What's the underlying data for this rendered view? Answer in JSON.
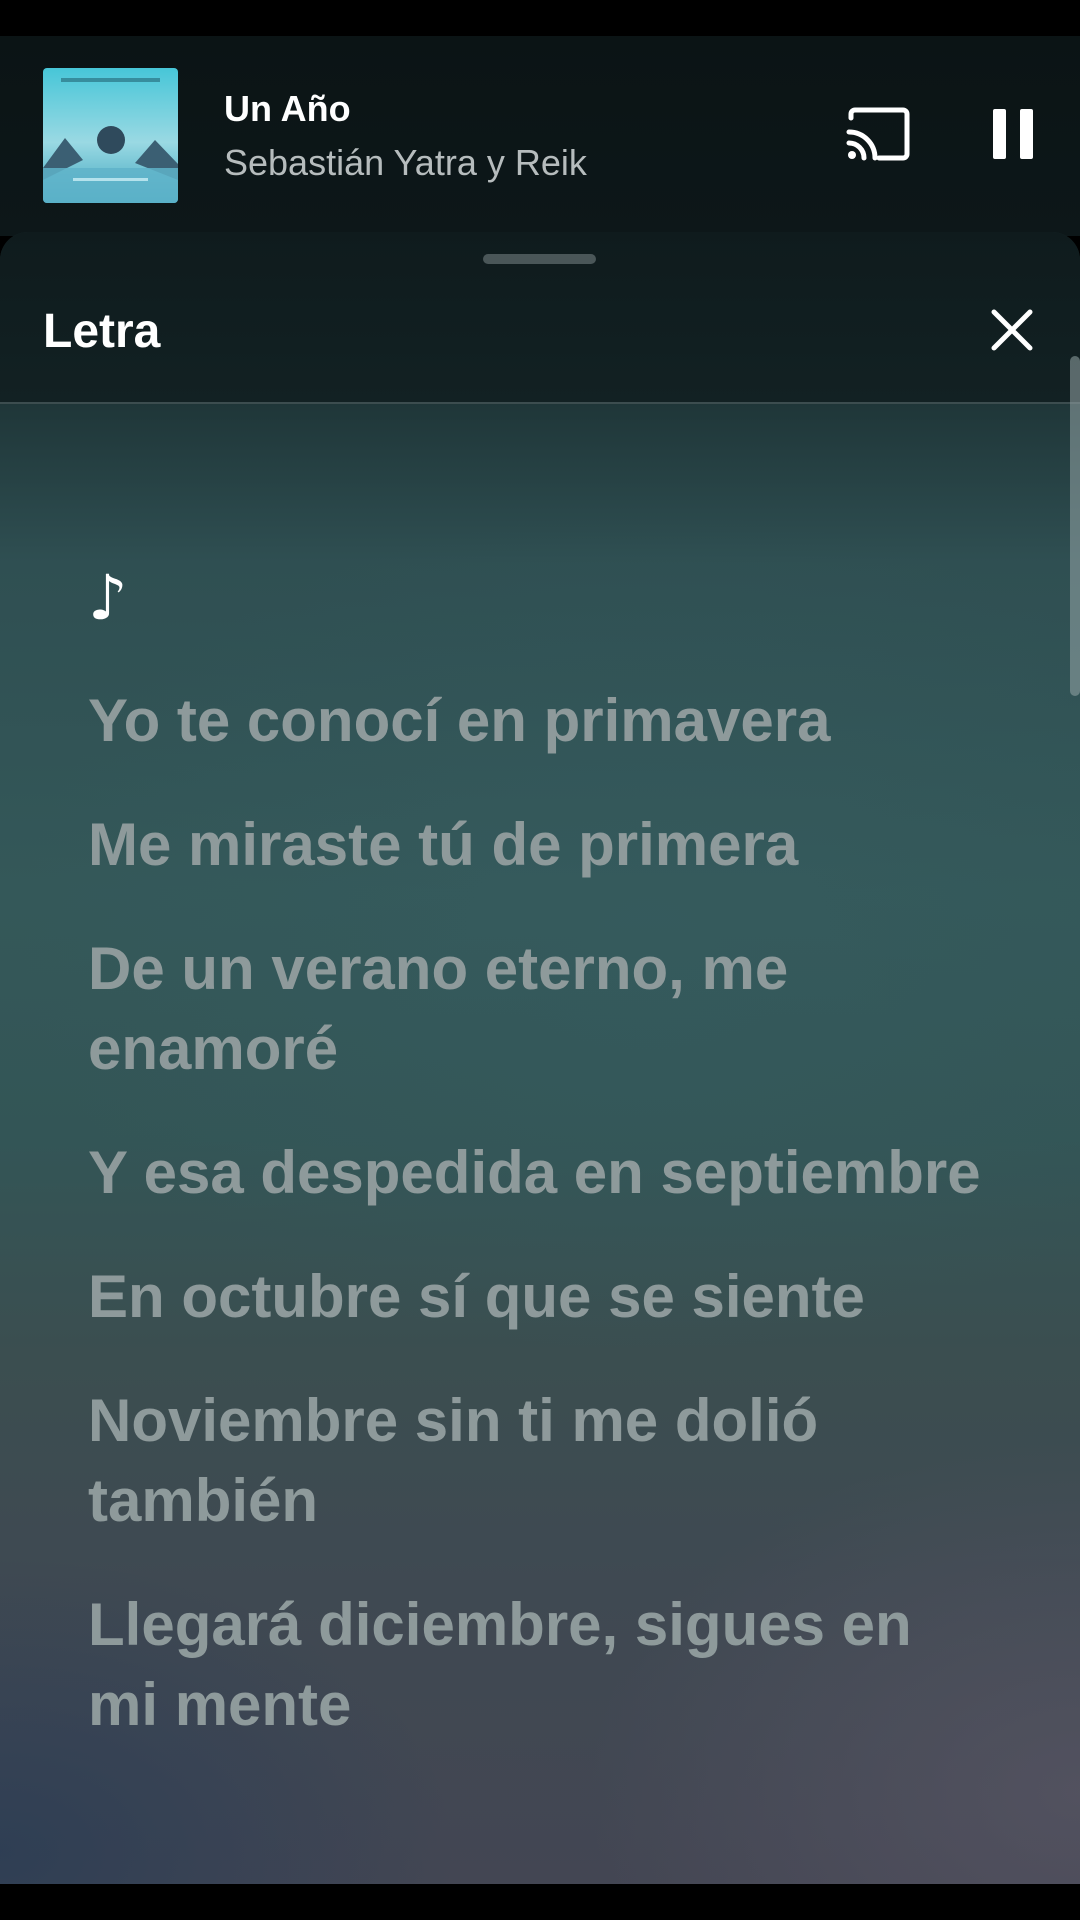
{
  "player": {
    "title": "Un Año",
    "artist": "Sebastián Yatra y Reik",
    "cast_icon": "cast-icon",
    "pause_icon": "pause-icon"
  },
  "lyrics_panel": {
    "title": "Letra",
    "close_icon": "close-icon",
    "note": "♪",
    "lines": [
      "Yo te conocí en primavera",
      "Me miraste tú de primera",
      "De un verano eterno, me enamoré",
      "Y esa despedida en septiembre",
      "En octubre sí que se siente",
      "Noviembre sin ti me dolió también",
      "Llegará diciembre, sigues en mi mente"
    ]
  },
  "colors": {
    "lyric_dim": "#8e9a9b",
    "accent_text": "#ffffff"
  }
}
